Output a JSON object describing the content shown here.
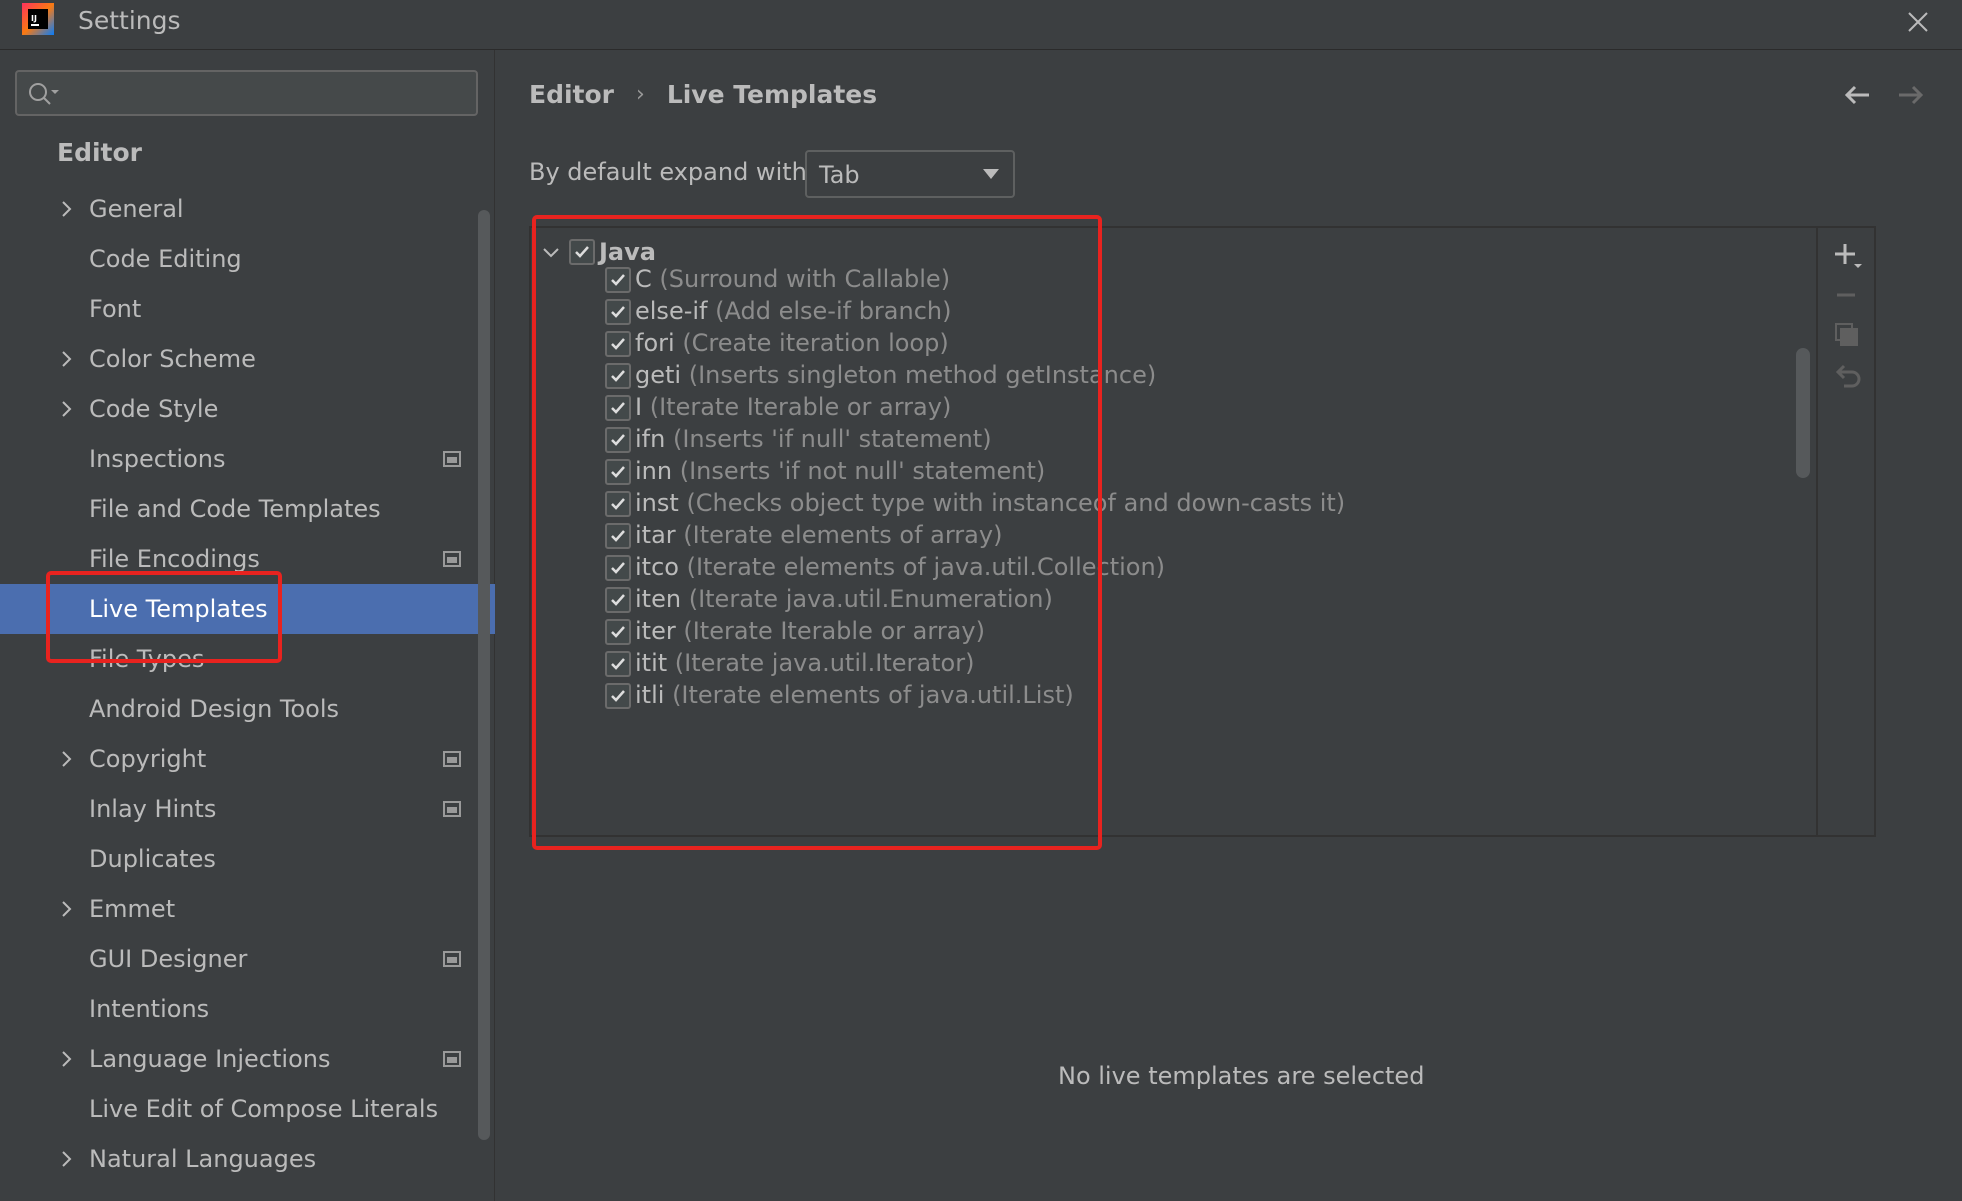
{
  "window": {
    "title": "Settings",
    "logo": "intellij-idea-logo"
  },
  "sidebar": {
    "search": {
      "value": "",
      "placeholder": ""
    },
    "heading": "Editor",
    "items": [
      {
        "label": "General",
        "expandable": true,
        "project_icon": false
      },
      {
        "label": "Code Editing",
        "expandable": false,
        "project_icon": false
      },
      {
        "label": "Font",
        "expandable": false,
        "project_icon": false
      },
      {
        "label": "Color Scheme",
        "expandable": true,
        "project_icon": false
      },
      {
        "label": "Code Style",
        "expandable": true,
        "project_icon": false
      },
      {
        "label": "Inspections",
        "expandable": false,
        "project_icon": true
      },
      {
        "label": "File and Code Templates",
        "expandable": false,
        "project_icon": false
      },
      {
        "label": "File Encodings",
        "expandable": false,
        "project_icon": true
      },
      {
        "label": "Live Templates",
        "expandable": false,
        "project_icon": false,
        "selected": true
      },
      {
        "label": "File Types",
        "expandable": false,
        "project_icon": false
      },
      {
        "label": "Android Design Tools",
        "expandable": false,
        "project_icon": false
      },
      {
        "label": "Copyright",
        "expandable": true,
        "project_icon": true
      },
      {
        "label": "Inlay Hints",
        "expandable": false,
        "project_icon": true
      },
      {
        "label": "Duplicates",
        "expandable": false,
        "project_icon": false
      },
      {
        "label": "Emmet",
        "expandable": true,
        "project_icon": false
      },
      {
        "label": "GUI Designer",
        "expandable": false,
        "project_icon": true
      },
      {
        "label": "Intentions",
        "expandable": false,
        "project_icon": false
      },
      {
        "label": "Language Injections",
        "expandable": true,
        "project_icon": true
      },
      {
        "label": "Live Edit of Compose Literals",
        "expandable": false,
        "project_icon": false
      },
      {
        "label": "Natural Languages",
        "expandable": true,
        "project_icon": false
      }
    ]
  },
  "main": {
    "breadcrumb": [
      "Editor",
      "Live Templates"
    ],
    "expand_label": "By default expand with",
    "expand_value": "Tab",
    "group": {
      "name": "Java",
      "checked": true,
      "expanded": true
    },
    "templates": [
      {
        "abbr": "C",
        "desc": "(Surround with Callable)",
        "checked": true
      },
      {
        "abbr": "else-if",
        "desc": "(Add else-if branch)",
        "checked": true
      },
      {
        "abbr": "fori",
        "desc": "(Create iteration loop)",
        "checked": true
      },
      {
        "abbr": "geti",
        "desc": "(Inserts singleton method getInstance)",
        "checked": true
      },
      {
        "abbr": "I",
        "desc": "(Iterate Iterable or array)",
        "checked": true
      },
      {
        "abbr": "ifn",
        "desc": "(Inserts 'if null' statement)",
        "checked": true
      },
      {
        "abbr": "inn",
        "desc": "(Inserts 'if not null' statement)",
        "checked": true
      },
      {
        "abbr": "inst",
        "desc": "(Checks object type with instanceof and down-casts it)",
        "checked": true
      },
      {
        "abbr": "itar",
        "desc": "(Iterate elements of array)",
        "checked": true
      },
      {
        "abbr": "itco",
        "desc": "(Iterate elements of java.util.Collection)",
        "checked": true
      },
      {
        "abbr": "iten",
        "desc": "(Iterate java.util.Enumeration)",
        "checked": true
      },
      {
        "abbr": "iter",
        "desc": "(Iterate Iterable or array)",
        "checked": true
      },
      {
        "abbr": "itit",
        "desc": "(Iterate java.util.Iterator)",
        "checked": true
      },
      {
        "abbr": "itli",
        "desc": "(Iterate elements of java.util.List)",
        "checked": true
      }
    ],
    "toolbar": [
      "add-icon",
      "remove-icon",
      "copy-icon",
      "restore-icon"
    ],
    "empty_message": "No live templates are selected"
  },
  "colors": {
    "background": "#3c3f41",
    "selection": "#4b6eaf",
    "annotation": "#e8231f",
    "description_text": "#8c8c8c"
  }
}
